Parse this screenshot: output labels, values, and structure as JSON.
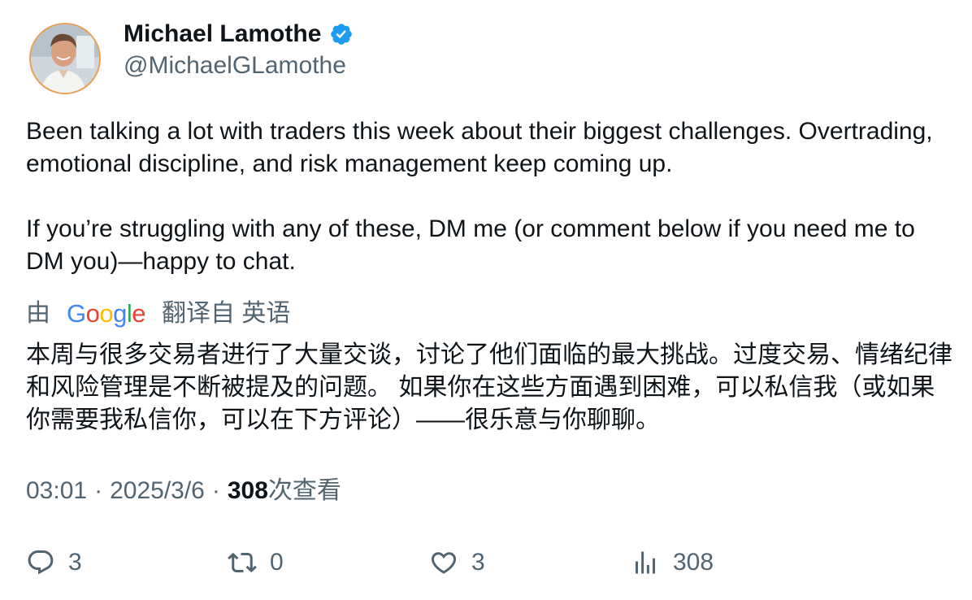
{
  "author": {
    "name": "Michael Lamothe",
    "handle": "@MichaelGLamothe",
    "verified": true
  },
  "tweet": {
    "paragraphs": [
      "Been talking a lot with traders this week about their biggest challenges. Overtrading, emotional discipline, and risk management keep coming up.",
      "If you’re struggling with any of these, DM me (or comment below if you need me to DM you)—happy to chat."
    ]
  },
  "translation": {
    "prefix": "由",
    "provider": "Google",
    "suffix": "翻译自 英语",
    "text": "本周与很多交易者进行了大量交谈，讨论了他们面临的最大挑战。过度交易、情绪纪律和风险管理是不断被提及的问题。 如果你在这些方面遇到困难，可以私信我（或如果你需要我私信你，可以在下方评论）——很乐意与你聊聊。"
  },
  "meta": {
    "time": "03:01",
    "separator": "·",
    "date": "2025/3/6",
    "views_count": "308",
    "views_label": "次查看"
  },
  "actions": {
    "replies": "3",
    "retweets": "0",
    "likes": "3",
    "views": "308"
  },
  "colors": {
    "text": "#0f1419",
    "secondary": "#536471",
    "verified_badge": "#1d9bf0",
    "avatar_ring": "#e9a055"
  },
  "icons": {
    "verified": "verified-badge-icon",
    "reply": "reply-icon",
    "retweet": "retweet-icon",
    "like": "heart-icon",
    "views": "analytics-icon"
  }
}
